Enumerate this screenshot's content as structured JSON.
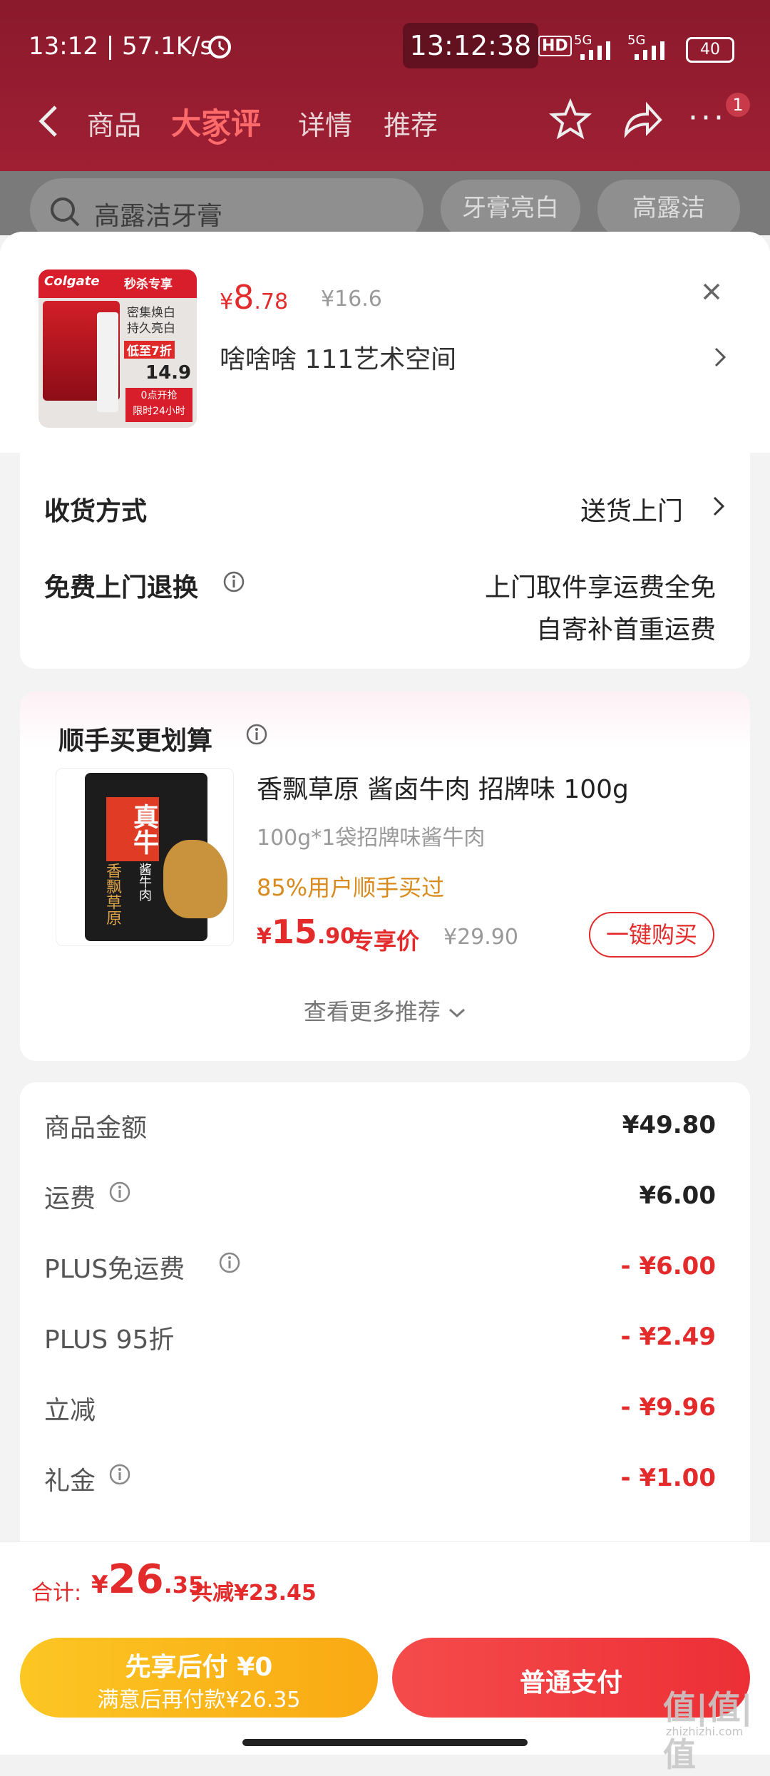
{
  "status_bar": {
    "time_speed": "13:12 | 57.1K/s",
    "clock_overlay": "13:12:38",
    "network_1": "5G",
    "network_2": "5G",
    "battery": "40"
  },
  "top_nav": {
    "tabs": [
      {
        "label": "商品"
      },
      {
        "label": "大家评"
      },
      {
        "label": "详情"
      },
      {
        "label": "推荐"
      }
    ],
    "notification_count": "1"
  },
  "search": {
    "placeholder": "高露洁牙膏",
    "chips": [
      "牙膏亮白",
      "高露洁"
    ]
  },
  "product": {
    "price_symbol": "¥",
    "price_int": "8",
    "price_dec": ".78",
    "original_price": "¥16.6",
    "name": "啥啥啥  111艺术空间",
    "image_texts": {
      "brand": "Colgate",
      "tag": "秒杀专享",
      "line1": "密集焕白",
      "line2": "持久亮白",
      "discount": "低至7折",
      "price": "14.9",
      "start1": "0点开抢",
      "start2": "限时24小时"
    }
  },
  "delivery": {
    "label": "收货方式",
    "value": "送货上门",
    "return_label": "免费上门退换",
    "return_line1": "上门取件享运费全免",
    "return_line2": "自寄补首重运费"
  },
  "recommend": {
    "title": "顺手买更划算",
    "item_name": "香飘草原 酱卤牛肉 招牌味 100g",
    "item_spec": "100g*1袋招牌味酱牛肉",
    "item_social": "85%用户顺手买过",
    "price_symbol": "¥",
    "price_int": "15",
    "price_dec": ".90",
    "price_tag": "专享价",
    "original_price": "¥29.90",
    "buy_button": "一键购买",
    "more": "查看更多推荐",
    "image_texts": {
      "big": "真牛",
      "sub": "酱牛肉",
      "brand": "香飘草原"
    }
  },
  "summary": {
    "rows": [
      {
        "label": "商品金额",
        "value": "¥49.80"
      },
      {
        "label": "运费",
        "value": "¥6.00"
      },
      {
        "label": "PLUS免运费",
        "value": "- ¥6.00"
      },
      {
        "label": "PLUS 95折",
        "value": "- ¥2.49"
      },
      {
        "label": "立减",
        "value": "- ¥9.96"
      },
      {
        "label": "礼金",
        "value": "- ¥1.00"
      }
    ]
  },
  "footer": {
    "total_label": "合计:",
    "total_symbol": "¥",
    "total_int": "26",
    "total_dec": ".35",
    "saved": "共减¥23.45",
    "pay_later_title": "先享后付 ¥0",
    "pay_later_sub": "满意后再付款¥26.35",
    "pay_normal": "普通支付"
  },
  "watermark": {
    "text": "值|值|值",
    "site": "zhizhizhi.com"
  },
  "colors": {
    "accent_red": "#e32b2b",
    "gold_button": "#fbb81c",
    "red_button": "#ef3c3c"
  }
}
